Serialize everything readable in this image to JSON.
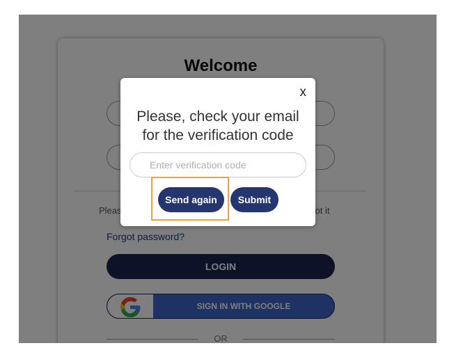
{
  "card": {
    "title": "Welcome",
    "hint_left": "Pleas",
    "hint_right": "rgot it",
    "forgot_link": "Forgot password?",
    "login_label": "LOGIN",
    "google_label": "SIGN IN WITH GOOGLE",
    "or_label": "OR"
  },
  "modal": {
    "close_label": "x",
    "message_line1": "Please, check your email",
    "message_line2": "for the verification code",
    "code_placeholder": "Enter verification code",
    "code_value": "",
    "send_again_label": "Send again",
    "submit_label": "Submit"
  },
  "colors": {
    "brand_navy": "#1a2550",
    "button_navy": "#253570",
    "google_blue": "#3c64c8",
    "highlight_orange": "#f0a050",
    "overlay": "rgba(0,0,0,0.5)"
  },
  "icons": {
    "google": "google-logo-icon",
    "close": "close-icon"
  }
}
